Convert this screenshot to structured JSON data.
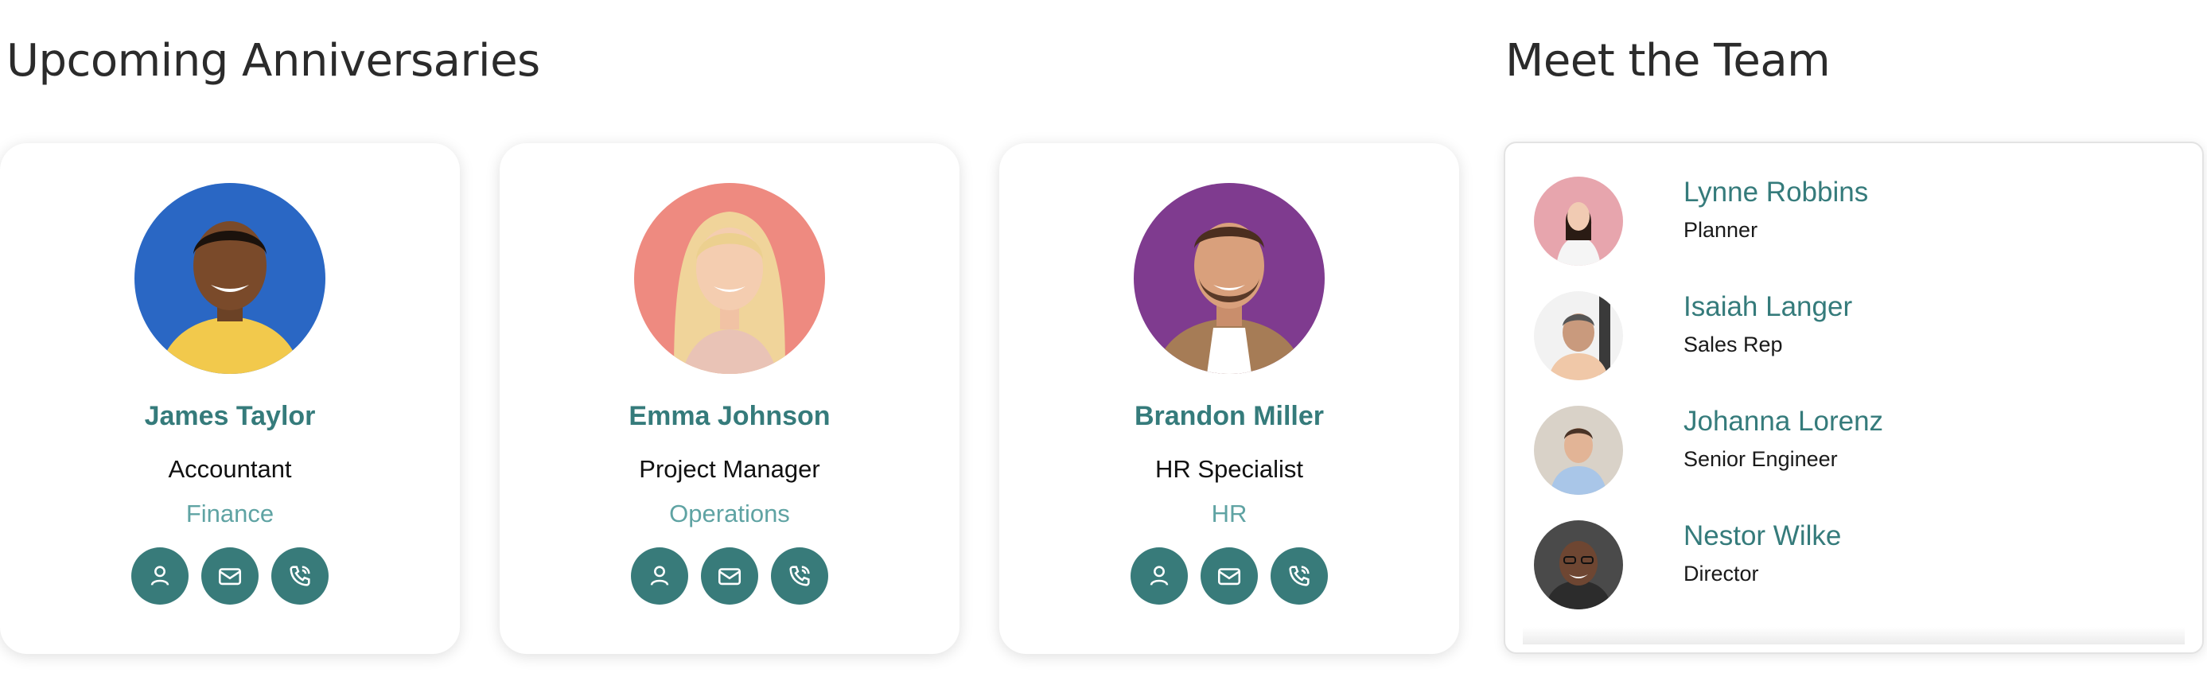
{
  "anniversaries": {
    "title": "Upcoming Anniversaries",
    "cards": [
      {
        "name": "James Taylor",
        "role": "Accountant",
        "department": "Finance",
        "avatar_bg": "#2a67c4"
      },
      {
        "name": "Emma Johnson",
        "role": "Project Manager",
        "department": "Operations",
        "avatar_bg": "#ee8a80"
      },
      {
        "name": "Brandon Miller",
        "role": "HR Specialist",
        "department": "HR",
        "avatar_bg": "#7f3b8f"
      }
    ],
    "action_icons": [
      "person-icon",
      "mail-icon",
      "phone-icon"
    ]
  },
  "team": {
    "title": "Meet the Team",
    "members": [
      {
        "name": "Lynne Robbins",
        "role": "Planner"
      },
      {
        "name": "Isaiah Langer",
        "role": "Sales Rep"
      },
      {
        "name": "Johanna Lorenz",
        "role": "Senior Engineer"
      },
      {
        "name": "Nestor Wilke",
        "role": "Director"
      }
    ]
  },
  "colors": {
    "accent": "#357b7b",
    "button": "#387b7a",
    "department": "#5fa3a3"
  }
}
